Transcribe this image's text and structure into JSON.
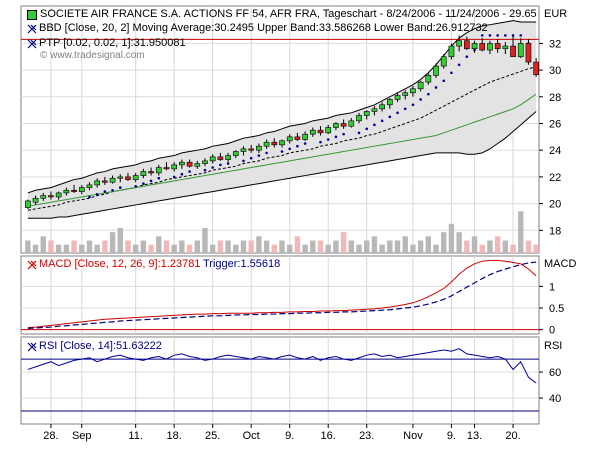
{
  "header": {
    "title": "SOCIETE AIR FRANCE S.A. ACTIONS FF 54, AFR FRA, Tageschart - 8/24/2006 - 11/24/2006 - 29.65",
    "bb_legend": "BBD [Close, 20, 2] Moving Average:30.2495 Upper Band:33.586268 Lower Band:26.912732",
    "ptp_legend": "PTP [0.02, 0.02, 1]:31.950081",
    "watermark": "© www.tradesignal.com",
    "currency": "EUR"
  },
  "macd_panel": {
    "legend_macd": "MACD [Close, 12, 26, 9]:1.23781",
    "legend_trigger": "Trigger:1.55618",
    "label": "MACD"
  },
  "rsi_panel": {
    "legend": "RSI [Close, 14]:51.63222",
    "label": "RSI"
  },
  "colors": {
    "up_candle": "#33cc33",
    "down_candle": "#dd2222",
    "band_fill": "#e3e3e3",
    "band_line": "#000000",
    "moving_average": "#000000",
    "long_ma": "#339933",
    "ptp": "#000099",
    "resistance": "#cc0000",
    "volume": "#b8b8b8",
    "volume_down": "#f0b8b8",
    "macd": "#cc0000",
    "trigger": "#000080",
    "rsi": "#000099",
    "rsi_level": "#000080"
  },
  "chart_data": {
    "type": "candlestick",
    "x_labels": [
      "28.",
      "Sep",
      "11.",
      "18.",
      "25.",
      "Oct",
      "9.",
      "16.",
      "23.",
      "Nov",
      "9.",
      "13.",
      "20."
    ],
    "x_label_index": [
      3,
      7,
      14,
      19,
      24,
      29,
      34,
      39,
      44,
      50,
      55,
      58,
      63
    ],
    "price_axis": {
      "ticks": [
        18,
        20,
        22,
        24,
        26,
        28,
        30,
        32
      ],
      "range": [
        16.3,
        34.8
      ]
    },
    "resistance_level": 32.3,
    "ohlc": [
      [
        19.7,
        20.3,
        19.6,
        20.2
      ],
      [
        20.1,
        20.6,
        19.9,
        20.4
      ],
      [
        20.4,
        20.8,
        20.2,
        20.6
      ],
      [
        20.6,
        20.9,
        20.3,
        20.5
      ],
      [
        20.5,
        20.9,
        20.3,
        20.8
      ],
      [
        20.8,
        21.2,
        20.6,
        21.0
      ],
      [
        21.0,
        21.4,
        20.8,
        20.9
      ],
      [
        20.9,
        21.4,
        20.7,
        21.2
      ],
      [
        21.2,
        21.6,
        21.0,
        21.4
      ],
      [
        21.4,
        21.9,
        21.2,
        21.7
      ],
      [
        21.7,
        22.0,
        21.4,
        21.6
      ],
      [
        21.6,
        22.1,
        21.5,
        21.9
      ],
      [
        21.9,
        22.2,
        21.6,
        22.0
      ],
      [
        22.0,
        22.3,
        21.7,
        21.8
      ],
      [
        21.8,
        22.3,
        21.6,
        22.1
      ],
      [
        22.1,
        22.6,
        21.9,
        22.4
      ],
      [
        22.4,
        22.7,
        22.1,
        22.3
      ],
      [
        22.3,
        22.9,
        22.1,
        22.7
      ],
      [
        22.7,
        23.1,
        22.5,
        22.6
      ],
      [
        22.6,
        23.1,
        22.4,
        22.9
      ],
      [
        22.9,
        23.3,
        22.6,
        23.1
      ],
      [
        23.1,
        23.3,
        22.7,
        22.8
      ],
      [
        22.8,
        23.2,
        22.6,
        23.0
      ],
      [
        23.0,
        23.4,
        22.8,
        23.2
      ],
      [
        23.2,
        23.7,
        23.0,
        23.5
      ],
      [
        23.5,
        23.8,
        23.2,
        23.3
      ],
      [
        23.3,
        23.8,
        23.1,
        23.6
      ],
      [
        23.6,
        24.0,
        23.4,
        23.9
      ],
      [
        23.9,
        24.3,
        23.6,
        24.1
      ],
      [
        24.1,
        24.4,
        23.8,
        24.0
      ],
      [
        24.0,
        24.5,
        23.8,
        24.3
      ],
      [
        24.3,
        24.8,
        24.1,
        24.6
      ],
      [
        24.6,
        24.9,
        24.2,
        24.4
      ],
      [
        24.4,
        24.8,
        24.2,
        24.7
      ],
      [
        24.7,
        25.2,
        24.5,
        25.0
      ],
      [
        25.0,
        25.3,
        24.7,
        24.8
      ],
      [
        24.8,
        25.4,
        24.7,
        25.2
      ],
      [
        25.2,
        25.7,
        25.0,
        25.5
      ],
      [
        25.5,
        25.8,
        25.1,
        25.3
      ],
      [
        25.3,
        25.9,
        25.2,
        25.7
      ],
      [
        25.7,
        26.1,
        25.5,
        26.0
      ],
      [
        26.0,
        26.3,
        25.6,
        25.8
      ],
      [
        25.8,
        26.4,
        25.7,
        26.2
      ],
      [
        26.2,
        26.8,
        26.0,
        26.6
      ],
      [
        26.6,
        27.0,
        26.3,
        26.9
      ],
      [
        26.9,
        27.3,
        26.6,
        27.1
      ],
      [
        27.1,
        27.6,
        26.9,
        27.4
      ],
      [
        27.4,
        27.9,
        27.1,
        27.8
      ],
      [
        27.8,
        28.3,
        27.6,
        28.1
      ],
      [
        28.1,
        28.5,
        27.8,
        28.3
      ],
      [
        28.3,
        28.8,
        28.0,
        28.6
      ],
      [
        28.6,
        29.2,
        28.4,
        29.1
      ],
      [
        29.1,
        29.8,
        28.9,
        29.6
      ],
      [
        29.6,
        30.5,
        29.4,
        30.3
      ],
      [
        30.3,
        31.2,
        30.1,
        31.0
      ],
      [
        31.0,
        32.0,
        30.8,
        31.8
      ],
      [
        31.8,
        32.6,
        31.4,
        32.2
      ],
      [
        32.2,
        32.5,
        31.5,
        31.6
      ],
      [
        31.6,
        32.2,
        31.3,
        32.0
      ],
      [
        32.0,
        32.4,
        31.4,
        31.5
      ],
      [
        31.5,
        32.2,
        31.2,
        32.0
      ],
      [
        32.0,
        32.3,
        31.3,
        31.6
      ],
      [
        31.6,
        32.1,
        31.2,
        31.8
      ],
      [
        31.8,
        32.6,
        31.0,
        31.0
      ],
      [
        31.0,
        32.4,
        30.9,
        32.0
      ],
      [
        32.0,
        32.3,
        30.4,
        30.6
      ],
      [
        30.6,
        30.9,
        29.5,
        29.65
      ]
    ],
    "bands": {
      "upper": [
        20.8,
        21.0,
        21.1,
        21.2,
        21.4,
        21.6,
        21.8,
        21.9,
        22.1,
        22.3,
        22.4,
        22.6,
        22.7,
        22.8,
        22.9,
        23.1,
        23.2,
        23.4,
        23.5,
        23.6,
        23.8,
        23.9,
        24.0,
        24.1,
        24.3,
        24.4,
        24.5,
        24.7,
        24.9,
        25.0,
        25.1,
        25.3,
        25.4,
        25.6,
        25.8,
        25.9,
        26.0,
        26.2,
        26.3,
        26.4,
        26.6,
        26.7,
        26.8,
        27.0,
        27.2,
        27.4,
        27.7,
        28.0,
        28.3,
        28.6,
        28.9,
        29.3,
        29.8,
        30.4,
        31.1,
        31.8,
        32.4,
        32.8,
        33.1,
        33.3,
        33.4,
        33.5,
        33.6,
        33.7,
        33.6,
        33.6,
        33.6
      ],
      "middle": [
        19.5,
        19.6,
        19.7,
        19.8,
        19.9,
        20.1,
        20.2,
        20.3,
        20.4,
        20.6,
        20.7,
        20.9,
        21.0,
        21.1,
        21.2,
        21.4,
        21.5,
        21.6,
        21.8,
        21.9,
        22.0,
        22.1,
        22.2,
        22.3,
        22.5,
        22.6,
        22.7,
        22.8,
        23.0,
        23.1,
        23.2,
        23.4,
        23.5,
        23.6,
        23.8,
        23.9,
        24.0,
        24.1,
        24.3,
        24.4,
        24.5,
        24.7,
        24.8,
        24.9,
        25.1,
        25.2,
        25.4,
        25.6,
        25.8,
        26.0,
        26.2,
        26.4,
        26.7,
        27.0,
        27.3,
        27.6,
        27.9,
        28.2,
        28.5,
        28.8,
        29.1,
        29.3,
        29.5,
        29.7,
        29.9,
        30.1,
        30.25
      ],
      "lower": [
        18.9,
        18.9,
        18.9,
        18.9,
        19.0,
        19.0,
        19.1,
        19.2,
        19.3,
        19.4,
        19.5,
        19.6,
        19.7,
        19.8,
        19.9,
        20.0,
        20.1,
        20.2,
        20.3,
        20.4,
        20.5,
        20.6,
        20.7,
        20.8,
        20.9,
        21.0,
        21.1,
        21.2,
        21.3,
        21.4,
        21.5,
        21.6,
        21.7,
        21.8,
        21.9,
        22.0,
        22.1,
        22.2,
        22.3,
        22.4,
        22.5,
        22.6,
        22.7,
        22.8,
        22.9,
        23.0,
        23.1,
        23.2,
        23.3,
        23.4,
        23.5,
        23.6,
        23.7,
        23.8,
        23.8,
        23.8,
        23.8,
        23.7,
        23.7,
        23.8,
        24.1,
        24.5,
        24.9,
        25.4,
        25.9,
        26.4,
        26.9
      ]
    },
    "long_ma": [
      19.8,
      19.9,
      20.0,
      20.1,
      20.2,
      20.3,
      20.4,
      20.5,
      20.6,
      20.7,
      20.8,
      20.9,
      21.0,
      21.1,
      21.2,
      21.3,
      21.4,
      21.5,
      21.6,
      21.7,
      21.8,
      21.9,
      22.0,
      22.1,
      22.2,
      22.3,
      22.4,
      22.5,
      22.6,
      22.7,
      22.8,
      22.9,
      23.0,
      23.1,
      23.2,
      23.3,
      23.4,
      23.5,
      23.6,
      23.7,
      23.8,
      23.9,
      24.0,
      24.1,
      24.2,
      24.3,
      24.4,
      24.5,
      24.6,
      24.7,
      24.8,
      24.9,
      25.0,
      25.1,
      25.3,
      25.5,
      25.7,
      25.9,
      26.1,
      26.3,
      26.5,
      26.7,
      26.9,
      27.1,
      27.4,
      27.8,
      28.2
    ],
    "ptp_points": [
      [
        8,
        20.5
      ],
      [
        9,
        20.7
      ],
      [
        10,
        20.9
      ],
      [
        11,
        21.0
      ],
      [
        12,
        21.2
      ],
      [
        14,
        21.3
      ],
      [
        15,
        21.5
      ],
      [
        16,
        21.7
      ],
      [
        17,
        21.9
      ],
      [
        19,
        22.0
      ],
      [
        20,
        22.2
      ],
      [
        21,
        22.4
      ],
      [
        23,
        22.5
      ],
      [
        24,
        22.7
      ],
      [
        25,
        22.9
      ],
      [
        26,
        23.0
      ],
      [
        28,
        23.2
      ],
      [
        29,
        23.4
      ],
      [
        30,
        23.6
      ],
      [
        31,
        23.8
      ],
      [
        33,
        23.9
      ],
      [
        34,
        24.1
      ],
      [
        35,
        24.3
      ],
      [
        36,
        24.5
      ],
      [
        38,
        24.6
      ],
      [
        39,
        24.8
      ],
      [
        40,
        25.0
      ],
      [
        41,
        25.2
      ],
      [
        43,
        25.3
      ],
      [
        44,
        25.6
      ],
      [
        45,
        25.9
      ],
      [
        46,
        26.2
      ],
      [
        47,
        26.5
      ],
      [
        48,
        26.8
      ],
      [
        49,
        27.1
      ],
      [
        50,
        27.4
      ],
      [
        51,
        27.8
      ],
      [
        52,
        28.2
      ],
      [
        53,
        28.7
      ],
      [
        54,
        29.2
      ],
      [
        55,
        29.8
      ],
      [
        56,
        30.4
      ],
      [
        57,
        31.0
      ],
      [
        58,
        31.5
      ],
      [
        59,
        32.6
      ],
      [
        60,
        32.6
      ],
      [
        61,
        32.6
      ],
      [
        62,
        32.6
      ],
      [
        63,
        32.6
      ],
      [
        64,
        32.6
      ],
      [
        65,
        32.0
      ]
    ],
    "volume": [
      3,
      2,
      4,
      3,
      2,
      2,
      3,
      2,
      3,
      2,
      3,
      5,
      6,
      3,
      2,
      3,
      2,
      4,
      3,
      2,
      3,
      2,
      3,
      6,
      2,
      3,
      3,
      2,
      3,
      3,
      4,
      3,
      2,
      3,
      2,
      4,
      2,
      3,
      3,
      2,
      3,
      5,
      3,
      2,
      3,
      4,
      2,
      3,
      3,
      4,
      2,
      3,
      4,
      2,
      5,
      7,
      5,
      3,
      4,
      2,
      3,
      4,
      3,
      2,
      10,
      3,
      2
    ],
    "macd_axis": {
      "ticks": [
        0,
        0.5,
        1
      ],
      "range": [
        -0.1,
        1.7
      ]
    },
    "macd": [
      0.05,
      0.06,
      0.08,
      0.1,
      0.12,
      0.14,
      0.16,
      0.18,
      0.2,
      0.22,
      0.24,
      0.25,
      0.26,
      0.27,
      0.28,
      0.29,
      0.3,
      0.31,
      0.32,
      0.33,
      0.34,
      0.35,
      0.36,
      0.36,
      0.37,
      0.37,
      0.38,
      0.38,
      0.38,
      0.38,
      0.39,
      0.39,
      0.4,
      0.4,
      0.41,
      0.41,
      0.42,
      0.42,
      0.43,
      0.43,
      0.44,
      0.44,
      0.45,
      0.46,
      0.47,
      0.48,
      0.5,
      0.52,
      0.55,
      0.58,
      0.62,
      0.68,
      0.76,
      0.85,
      0.95,
      1.1,
      1.28,
      1.42,
      1.52,
      1.58,
      1.6,
      1.6,
      1.58,
      1.55,
      1.52,
      1.4,
      1.24
    ],
    "trigger": [
      0.03,
      0.04,
      0.05,
      0.06,
      0.08,
      0.09,
      0.11,
      0.12,
      0.14,
      0.15,
      0.17,
      0.18,
      0.2,
      0.21,
      0.22,
      0.23,
      0.24,
      0.25,
      0.26,
      0.27,
      0.28,
      0.29,
      0.3,
      0.31,
      0.32,
      0.32,
      0.33,
      0.34,
      0.34,
      0.35,
      0.35,
      0.36,
      0.36,
      0.37,
      0.37,
      0.38,
      0.38,
      0.39,
      0.39,
      0.4,
      0.4,
      0.41,
      0.41,
      0.42,
      0.43,
      0.44,
      0.45,
      0.46,
      0.48,
      0.5,
      0.52,
      0.55,
      0.59,
      0.64,
      0.7,
      0.78,
      0.88,
      0.98,
      1.08,
      1.18,
      1.27,
      1.34,
      1.4,
      1.45,
      1.5,
      1.54,
      1.56
    ],
    "rsi_axis": {
      "ticks": [
        40,
        60
      ],
      "range": [
        20,
        87
      ]
    },
    "rsi_levels": [
      70,
      30
    ],
    "rsi": [
      62,
      64,
      66,
      68,
      65,
      67,
      69,
      70,
      71,
      68,
      70,
      72,
      73,
      71,
      70,
      69,
      71,
      72,
      70,
      73,
      74,
      72,
      71,
      69,
      70,
      72,
      73,
      72,
      71,
      70,
      72,
      71,
      70,
      72,
      73,
      71,
      70,
      72,
      69,
      71,
      72,
      70,
      69,
      71,
      73,
      74,
      72,
      73,
      71,
      72,
      73,
      74,
      75,
      76,
      77,
      76,
      78,
      74,
      73,
      72,
      71,
      72,
      70,
      62,
      68,
      56,
      51.6
    ]
  }
}
